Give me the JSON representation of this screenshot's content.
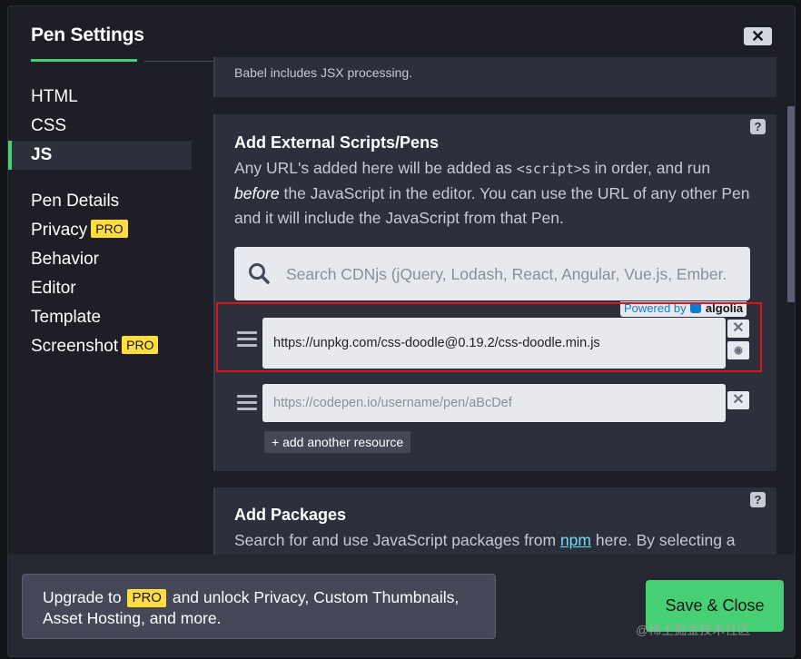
{
  "modal": {
    "title": "Pen Settings",
    "close_symbol": "✕"
  },
  "sidebar": {
    "items": [
      {
        "label": "HTML"
      },
      {
        "label": "CSS"
      },
      {
        "label": "JS",
        "active": true
      },
      {
        "label": "Pen Details"
      },
      {
        "label": "Privacy",
        "badge": "PRO"
      },
      {
        "label": "Behavior"
      },
      {
        "label": "Editor"
      },
      {
        "label": "Template"
      },
      {
        "label": "Screenshot",
        "badge": "PRO"
      }
    ]
  },
  "preprocessor": {
    "note": "Babel includes JSX processing."
  },
  "external": {
    "heading": "Add External Scripts/Pens",
    "help": "?",
    "desc_1": "Any URL's added here will be added as ",
    "desc_code": "<script>",
    "desc_2": "s in order, and run",
    "desc_em": "before",
    "desc_3": " the JavaScript in the editor. You can use the URL of any other Pen and it will include the JavaScript from that Pen.",
    "search_placeholder": "Search CDNjs (jQuery, Lodash, React, Angular, Vue.js, Ember.",
    "powered_by": "Powered by",
    "powered_brand": "algolia",
    "resources": [
      {
        "value": "https://unpkg.com/css-doodle@0.19.2/css-doodle.min.js",
        "placeholder": ""
      },
      {
        "value": "",
        "placeholder": "https://codepen.io/username/pen/aBcDef"
      }
    ],
    "remove_symbol": "✕",
    "view_symbol": "◉",
    "add_resource": "+ add another resource"
  },
  "packages": {
    "heading": "Add Packages",
    "help": "?",
    "desc_1": "Search for and use JavaScript packages from ",
    "desc_link": "npm",
    "desc_2": " here. By selecting a"
  },
  "footer": {
    "upgrade_1": "Upgrade to ",
    "upgrade_badge": "PRO",
    "upgrade_2": " and unlock Privacy, Custom Thumbnails, Asset Hosting, and more.",
    "save_label": "Save & Close"
  },
  "watermark": "@稀土掘金技术社区",
  "colors": {
    "accent": "#47cf73",
    "pro_badge": "#ffdd40",
    "highlight": "#e0131d"
  }
}
